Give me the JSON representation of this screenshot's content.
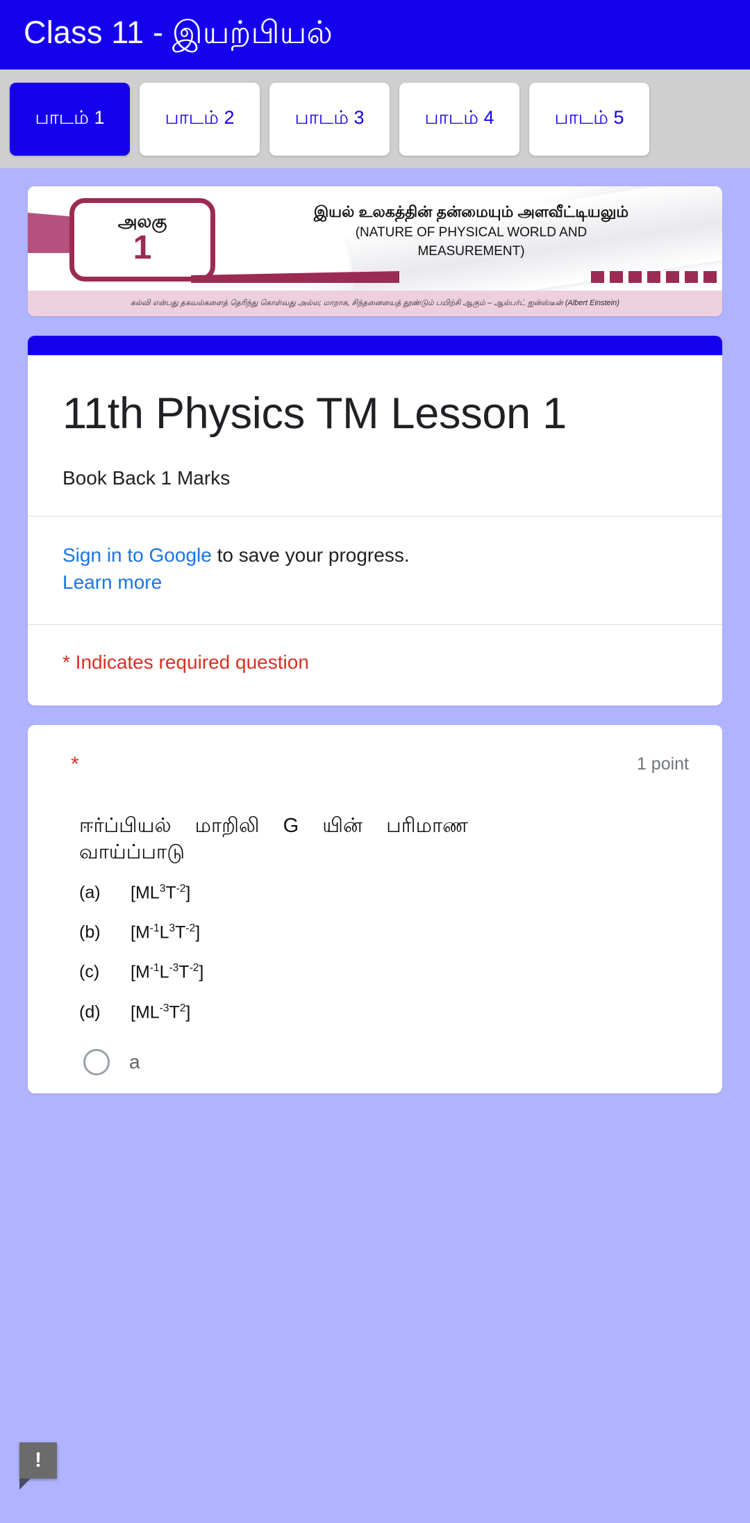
{
  "app": {
    "title": "Class 11 - இயற்பியல்",
    "appbar_color": "#1500ee"
  },
  "tabs": [
    {
      "label": "பாடம் 1",
      "active": true
    },
    {
      "label": "பாடம் 2",
      "active": false
    },
    {
      "label": "பாடம் 3",
      "active": false
    },
    {
      "label": "பாடம் 4",
      "active": false
    },
    {
      "label": "பாடம் 5",
      "active": false
    }
  ],
  "banner": {
    "unit_word": "அலகு",
    "unit_number": "1",
    "title_tamil": "இயல் உலகத்தின் தன்மையும் அளவீட்டியலும்",
    "title_english_line1": "(NATURE OF PHYSICAL WORLD AND",
    "title_english_line2": "MEASUREMENT)",
    "quote": "கல்வி என்பது தகவல்களைத் தெரிந்து கொள்வது அல்ல; மாறாக, சிந்தனையைத் தூண்டும் பயிற்சி ஆகும் – ஆல்பர்ட் ஐன்ஸ்டீன் (Albert Einstein)",
    "accent_color": "#9c2b54"
  },
  "form": {
    "title": "11th Physics TM Lesson 1",
    "description": "Book Back 1 Marks",
    "signin_link": "Sign in to Google",
    "signin_rest": " to save your progress.",
    "learn_more": "Learn more",
    "required_note": "* Indicates required question",
    "required_color": "#d93025",
    "link_color": "#1a73e8"
  },
  "question": {
    "required_marker": "*",
    "points": "1 point",
    "text": "ஈர்ப்பியல் மாறிலி G யின் பரிமாண வாய்ப்பாடு",
    "options": [
      {
        "label": "(a)",
        "m": "M",
        "m_exp": "",
        "l": "L",
        "l_exp": "3",
        "t": "T",
        "t_exp": "-2"
      },
      {
        "label": "(b)",
        "m": "M",
        "m_exp": "-1",
        "l": "L",
        "l_exp": "3",
        "t": "T",
        "t_exp": "-2"
      },
      {
        "label": "(c)",
        "m": "M",
        "m_exp": "-1",
        "l": "L",
        "l_exp": "-3",
        "t": "T",
        "t_exp": "-2"
      },
      {
        "label": "(d)",
        "m": "M",
        "m_exp": "",
        "l": "L",
        "l_exp": "-3",
        "t": "T",
        "t_exp": "2"
      }
    ],
    "choices": [
      {
        "label": "a",
        "selected": false
      }
    ]
  },
  "fab": {
    "glyph": "!"
  }
}
